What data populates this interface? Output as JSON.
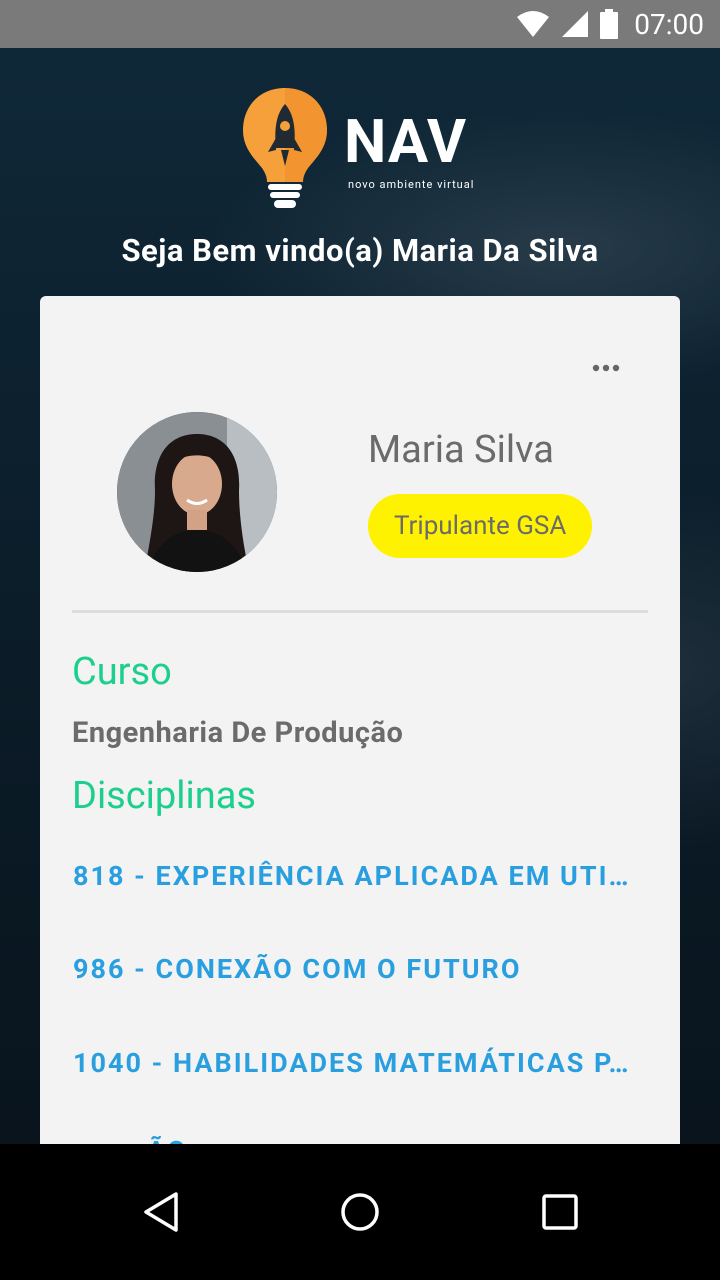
{
  "status_bar": {
    "time": "07:00",
    "icons": [
      "wifi-icon",
      "signal-icon",
      "battery-icon"
    ]
  },
  "logo": {
    "brand": "NAV",
    "tagline": "novo ambiente virtual"
  },
  "welcome_text": "Seja Bem vindo(a) Maria Da Silva",
  "profile": {
    "name": "Maria Silva",
    "role_badge": "Tripulante GSA"
  },
  "course": {
    "label": "Curso",
    "value": "Engenharia De Produção"
  },
  "disciplines": {
    "label": "Disciplinas",
    "items": [
      "818 - EXPERIÊNCIA APLICADA EM UTI…",
      "986 - CONEXÃO COM O FUTURO",
      "1040 - HABILIDADES MATEMÁTICAS P…",
      "… - …ÃO…"
    ]
  },
  "colors": {
    "accent_green": "#1ccf8c",
    "link_blue": "#2a9fdf",
    "badge_yellow": "#fff200",
    "logo_orange": "#f5a03a"
  },
  "nav_bar": {
    "icons": [
      "back-icon",
      "home-icon",
      "recents-icon"
    ]
  }
}
